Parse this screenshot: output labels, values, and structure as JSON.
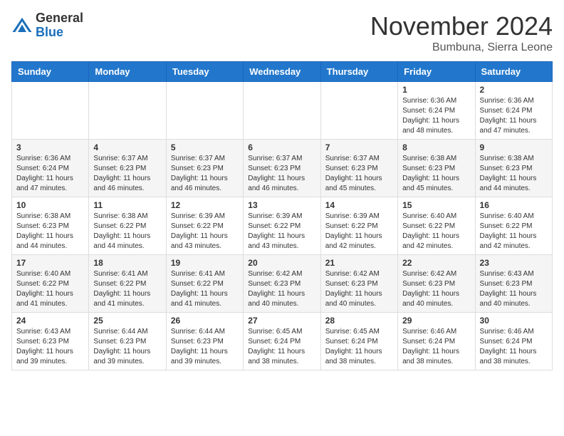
{
  "header": {
    "logo_line1": "General",
    "logo_line2": "Blue",
    "month": "November 2024",
    "location": "Bumbuna, Sierra Leone"
  },
  "weekdays": [
    "Sunday",
    "Monday",
    "Tuesday",
    "Wednesday",
    "Thursday",
    "Friday",
    "Saturday"
  ],
  "weeks": [
    [
      {
        "day": "",
        "info": ""
      },
      {
        "day": "",
        "info": ""
      },
      {
        "day": "",
        "info": ""
      },
      {
        "day": "",
        "info": ""
      },
      {
        "day": "",
        "info": ""
      },
      {
        "day": "1",
        "info": "Sunrise: 6:36 AM\nSunset: 6:24 PM\nDaylight: 11 hours\nand 48 minutes."
      },
      {
        "day": "2",
        "info": "Sunrise: 6:36 AM\nSunset: 6:24 PM\nDaylight: 11 hours\nand 47 minutes."
      }
    ],
    [
      {
        "day": "3",
        "info": "Sunrise: 6:36 AM\nSunset: 6:24 PM\nDaylight: 11 hours\nand 47 minutes."
      },
      {
        "day": "4",
        "info": "Sunrise: 6:37 AM\nSunset: 6:23 PM\nDaylight: 11 hours\nand 46 minutes."
      },
      {
        "day": "5",
        "info": "Sunrise: 6:37 AM\nSunset: 6:23 PM\nDaylight: 11 hours\nand 46 minutes."
      },
      {
        "day": "6",
        "info": "Sunrise: 6:37 AM\nSunset: 6:23 PM\nDaylight: 11 hours\nand 46 minutes."
      },
      {
        "day": "7",
        "info": "Sunrise: 6:37 AM\nSunset: 6:23 PM\nDaylight: 11 hours\nand 45 minutes."
      },
      {
        "day": "8",
        "info": "Sunrise: 6:38 AM\nSunset: 6:23 PM\nDaylight: 11 hours\nand 45 minutes."
      },
      {
        "day": "9",
        "info": "Sunrise: 6:38 AM\nSunset: 6:23 PM\nDaylight: 11 hours\nand 44 minutes."
      }
    ],
    [
      {
        "day": "10",
        "info": "Sunrise: 6:38 AM\nSunset: 6:23 PM\nDaylight: 11 hours\nand 44 minutes."
      },
      {
        "day": "11",
        "info": "Sunrise: 6:38 AM\nSunset: 6:22 PM\nDaylight: 11 hours\nand 44 minutes."
      },
      {
        "day": "12",
        "info": "Sunrise: 6:39 AM\nSunset: 6:22 PM\nDaylight: 11 hours\nand 43 minutes."
      },
      {
        "day": "13",
        "info": "Sunrise: 6:39 AM\nSunset: 6:22 PM\nDaylight: 11 hours\nand 43 minutes."
      },
      {
        "day": "14",
        "info": "Sunrise: 6:39 AM\nSunset: 6:22 PM\nDaylight: 11 hours\nand 42 minutes."
      },
      {
        "day": "15",
        "info": "Sunrise: 6:40 AM\nSunset: 6:22 PM\nDaylight: 11 hours\nand 42 minutes."
      },
      {
        "day": "16",
        "info": "Sunrise: 6:40 AM\nSunset: 6:22 PM\nDaylight: 11 hours\nand 42 minutes."
      }
    ],
    [
      {
        "day": "17",
        "info": "Sunrise: 6:40 AM\nSunset: 6:22 PM\nDaylight: 11 hours\nand 41 minutes."
      },
      {
        "day": "18",
        "info": "Sunrise: 6:41 AM\nSunset: 6:22 PM\nDaylight: 11 hours\nand 41 minutes."
      },
      {
        "day": "19",
        "info": "Sunrise: 6:41 AM\nSunset: 6:22 PM\nDaylight: 11 hours\nand 41 minutes."
      },
      {
        "day": "20",
        "info": "Sunrise: 6:42 AM\nSunset: 6:23 PM\nDaylight: 11 hours\nand 40 minutes."
      },
      {
        "day": "21",
        "info": "Sunrise: 6:42 AM\nSunset: 6:23 PM\nDaylight: 11 hours\nand 40 minutes."
      },
      {
        "day": "22",
        "info": "Sunrise: 6:42 AM\nSunset: 6:23 PM\nDaylight: 11 hours\nand 40 minutes."
      },
      {
        "day": "23",
        "info": "Sunrise: 6:43 AM\nSunset: 6:23 PM\nDaylight: 11 hours\nand 40 minutes."
      }
    ],
    [
      {
        "day": "24",
        "info": "Sunrise: 6:43 AM\nSunset: 6:23 PM\nDaylight: 11 hours\nand 39 minutes."
      },
      {
        "day": "25",
        "info": "Sunrise: 6:44 AM\nSunset: 6:23 PM\nDaylight: 11 hours\nand 39 minutes."
      },
      {
        "day": "26",
        "info": "Sunrise: 6:44 AM\nSunset: 6:23 PM\nDaylight: 11 hours\nand 39 minutes."
      },
      {
        "day": "27",
        "info": "Sunrise: 6:45 AM\nSunset: 6:24 PM\nDaylight: 11 hours\nand 38 minutes."
      },
      {
        "day": "28",
        "info": "Sunrise: 6:45 AM\nSunset: 6:24 PM\nDaylight: 11 hours\nand 38 minutes."
      },
      {
        "day": "29",
        "info": "Sunrise: 6:46 AM\nSunset: 6:24 PM\nDaylight: 11 hours\nand 38 minutes."
      },
      {
        "day": "30",
        "info": "Sunrise: 6:46 AM\nSunset: 6:24 PM\nDaylight: 11 hours\nand 38 minutes."
      }
    ]
  ]
}
